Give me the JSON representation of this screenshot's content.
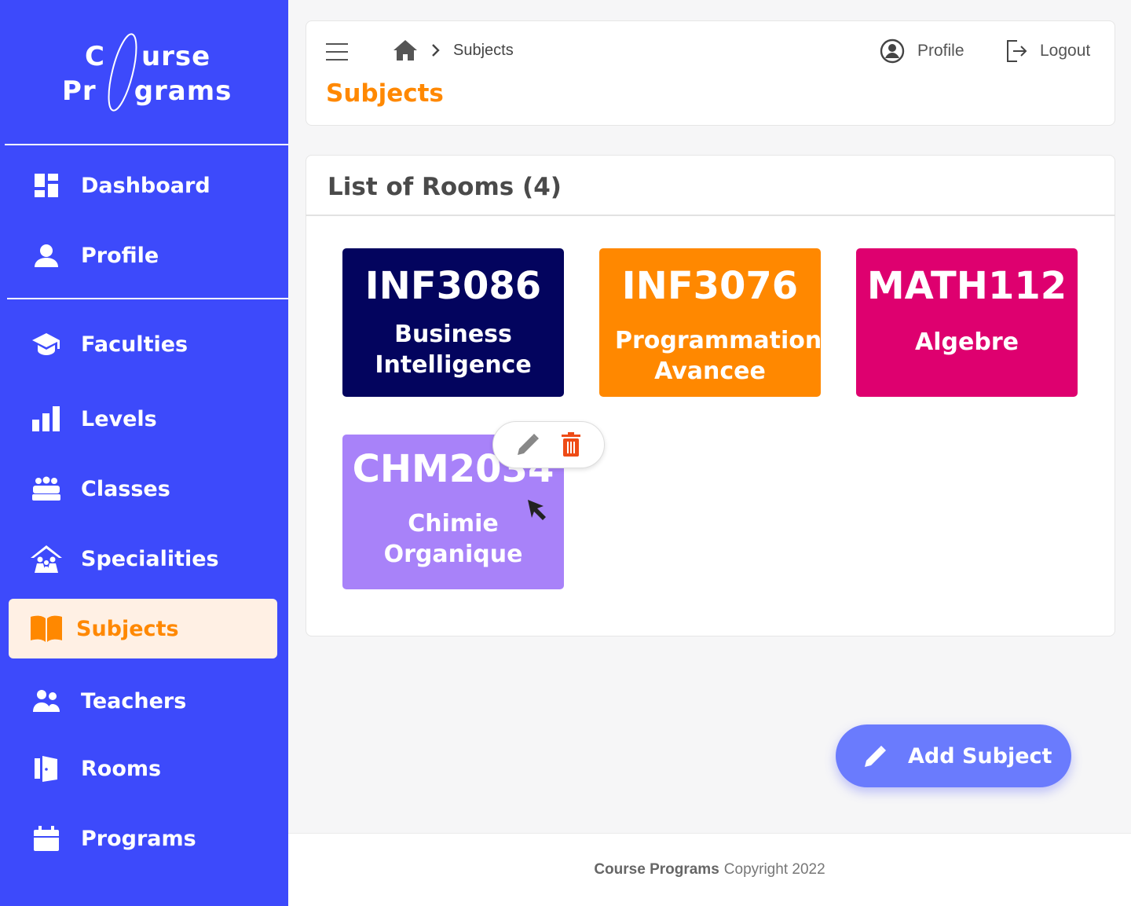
{
  "app": {
    "logo_line1_a": "C",
    "logo_line1_b": "urse",
    "logo_line2_a": "Pr",
    "logo_line2_b": "grams"
  },
  "sidebar": {
    "items": [
      {
        "label": "Dashboard",
        "icon": "dashboard-icon"
      },
      {
        "label": "Profile",
        "icon": "person-icon"
      },
      {
        "label": "Faculties",
        "icon": "graduation-cap-icon"
      },
      {
        "label": "Levels",
        "icon": "bar-chart-icon"
      },
      {
        "label": "Classes",
        "icon": "group-icon"
      },
      {
        "label": "Specialities",
        "icon": "family-house-icon"
      },
      {
        "label": "Subjects",
        "icon": "open-book-icon",
        "active": true
      },
      {
        "label": "Teachers",
        "icon": "people-icon"
      },
      {
        "label": "Rooms",
        "icon": "door-icon"
      },
      {
        "label": "Programs",
        "icon": "calendar-icon"
      }
    ],
    "bg_color": "#3d4afb",
    "active_bg": "#fff0e4",
    "active_color": "#ff8800"
  },
  "header": {
    "breadcrumb": "Subjects",
    "title": "Subjects",
    "profile_label": "Profile",
    "logout_label": "Logout"
  },
  "rooms": {
    "title": "List of Rooms (4)",
    "items": [
      {
        "code": "INF3086",
        "name": "Business Intelligence",
        "color": "#03045e"
      },
      {
        "code": "INF3076",
        "name": "Programmation Avancee",
        "color": "#ff8800"
      },
      {
        "code": "MATH112",
        "name": "Algebre",
        "color": "#de006f"
      },
      {
        "code": "CHM2034",
        "name": "Chimie Organique",
        "color": "#a882f9"
      }
    ]
  },
  "fab": {
    "label": "Add Subject"
  },
  "footer": {
    "brand": "Course Programs",
    "text": "Copyright 2022"
  }
}
